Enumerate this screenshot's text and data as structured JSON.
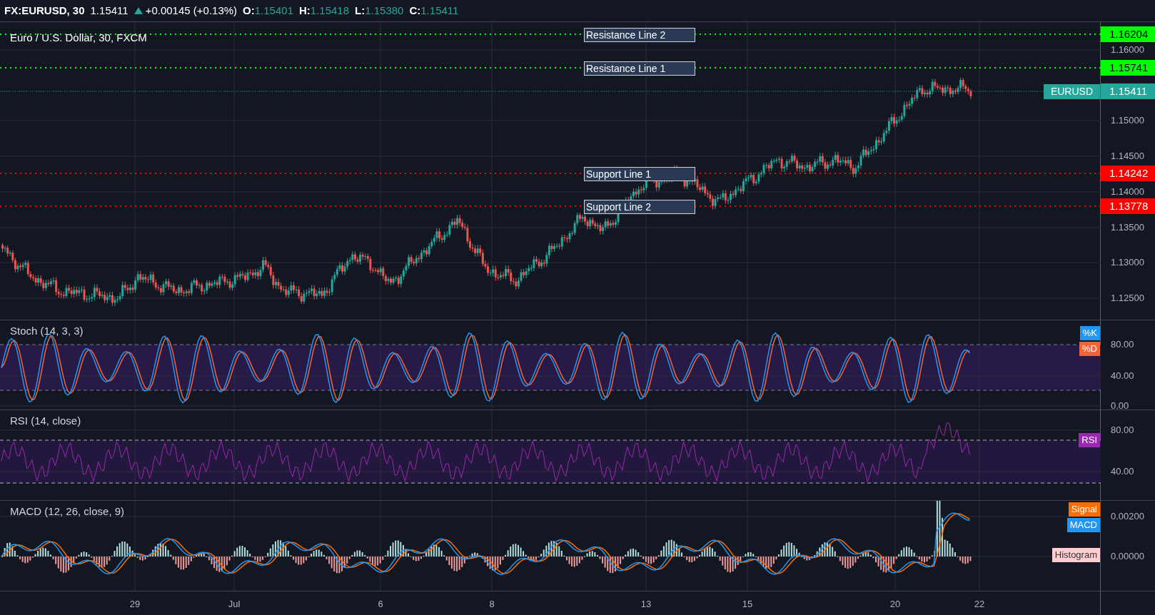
{
  "header": {
    "symbol": "FX:EURUSD, 30",
    "price": "1.15411",
    "change": "+0.00145 (+0.13%)",
    "ohlc": [
      {
        "label": "O:",
        "value": "1.15401"
      },
      {
        "label": "H:",
        "value": "1.15418"
      },
      {
        "label": "L:",
        "value": "1.15380"
      },
      {
        "label": "C:",
        "value": "1.15411"
      }
    ]
  },
  "main_pane": {
    "title": "Euro / U.S. Dollar, 30, FXCM",
    "levels": [
      {
        "kind": "resistance",
        "label": "Resistance Line 2",
        "price": "1.16204"
      },
      {
        "kind": "resistance",
        "label": "Resistance Line 1",
        "price": "1.15741"
      },
      {
        "kind": "support",
        "label": "Support Line 1",
        "price": "1.14242"
      },
      {
        "kind": "support",
        "label": "Support Line 2",
        "price": "1.13778"
      }
    ],
    "current": {
      "symbol": "EURUSD",
      "price": "1.15411"
    },
    "axis_ticks": [
      "1.16000",
      "1.15000",
      "1.14500",
      "1.14000",
      "1.13500",
      "1.13000",
      "1.12500"
    ]
  },
  "stoch_pane": {
    "title": "Stoch (14, 3, 3)",
    "legend": [
      {
        "label": "%K",
        "color": "#2196f3"
      },
      {
        "label": "%D",
        "color": "#f0643c"
      }
    ],
    "axis_ticks": [
      "80.00",
      "40.00",
      "0.00"
    ]
  },
  "rsi_pane": {
    "title": "RSI (14, close)",
    "legend": [
      {
        "label": "RSI",
        "color": "#9c27b0"
      }
    ],
    "axis_ticks": [
      "80.00",
      "40.00"
    ]
  },
  "macd_pane": {
    "title": "MACD (12, 26, close, 9)",
    "legend": [
      {
        "label": "Signal",
        "color": "#ff6d00"
      },
      {
        "label": "MACD",
        "color": "#2196f3"
      },
      {
        "label": "Histogram",
        "color": "#ffcdd2"
      }
    ],
    "axis_ticks": [
      "0.00200",
      "0.00000"
    ]
  },
  "time_axis": [
    "29",
    "Jul",
    "6",
    "8",
    "13",
    "15",
    "20",
    "22"
  ]
}
